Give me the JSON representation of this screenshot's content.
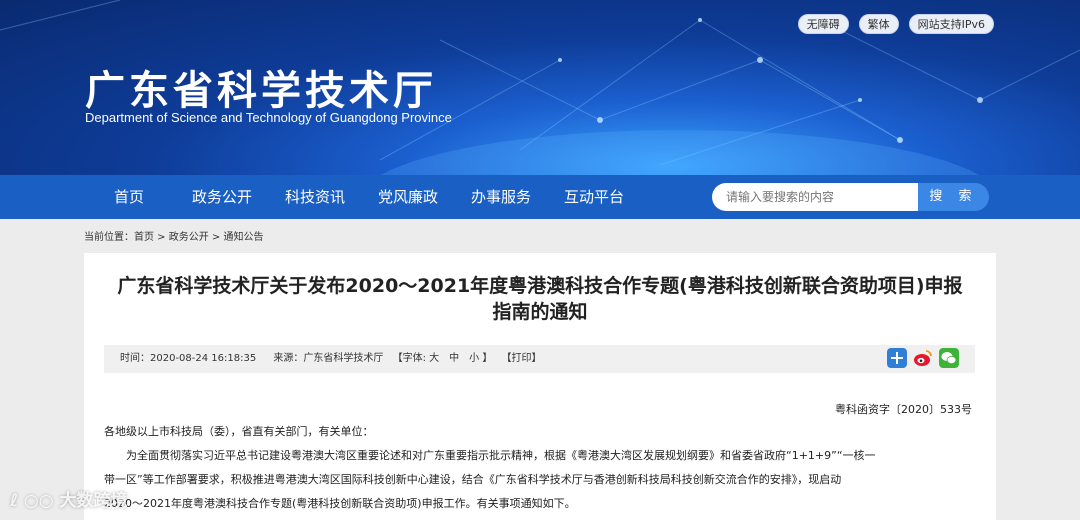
{
  "header": {
    "title": "广东省科学技术厅",
    "subtitle": "Department of Science and Technology of Guangdong Province",
    "top_buttons": [
      "无障碍",
      "繁体",
      "网站支持IPv6"
    ]
  },
  "nav": {
    "items": [
      "首页",
      "政务公开",
      "科技资讯",
      "党风廉政",
      "办事服务",
      "互动平台"
    ],
    "search_placeholder": "请输入要搜索的内容",
    "search_button": "搜 索"
  },
  "breadcrumb": "当前位置：首页 > 政务公开 > 通知公告",
  "article": {
    "title_line1": "广东省科学技术厅关于发布2020～2021年度粤港澳科技合作专题(粤港科技创新联合资助项目)申报",
    "title_line2": "指南的通知",
    "meta_time": "时间：2020-08-24 16:18:35",
    "meta_source": "来源：广东省科学技术厅",
    "meta_font": "【字体: 大　中　小 】",
    "meta_print": "【打印】",
    "doc_number": "粤科函资字〔2020〕533号",
    "addressee": "各地级以上市科技局（委），省直有关部门，有关单位：",
    "para1_line1": "为全面贯彻落实习近平总书记建设粤港澳大湾区重要论述和对广东重要指示批示精神，根据《粤港澳大湾区发展规划纲要》和省委省政府“1+1+9”“一核一",
    "para1_line2": "带一区”等工作部署要求，积极推进粤港澳大湾区国际科技创新中心建设，结合《广东省科学技术厅与香港创新科技局科技创新交流合作的安排》，现启动",
    "para1_line3": "2020～2021年度粤港澳科技合作专题(粤港科技创新联合资助项)申报工作。有关事项通知如下。"
  },
  "share_icons": [
    "share-plus-icon",
    "weibo-icon",
    "wechat-icon"
  ],
  "watermark": "大数跨境",
  "colors": {
    "nav": "#1a5fc3",
    "search_button": "#3b87e6",
    "banner": "#0e3c98"
  }
}
